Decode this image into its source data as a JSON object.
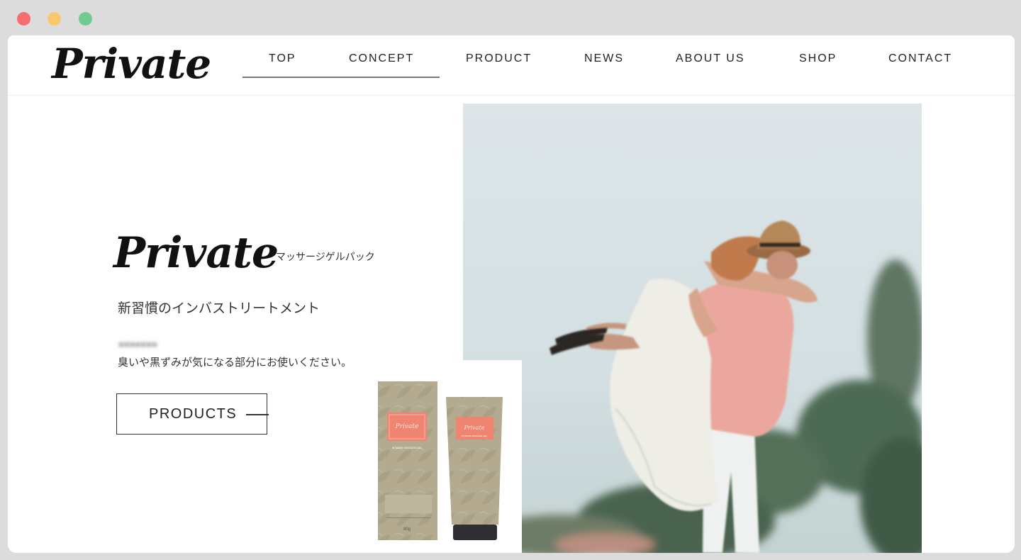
{
  "window": {
    "colors": {
      "close": "#f76d6f",
      "minimize": "#f9c86b",
      "maximize": "#72cb8e"
    }
  },
  "header": {
    "logo": "Private",
    "nav": [
      {
        "label": "TOP"
      },
      {
        "label": "CONCEPT"
      },
      {
        "label": "PRODUCT"
      },
      {
        "label": "NEWS"
      },
      {
        "label": "ABOUT US"
      },
      {
        "label": "SHOP"
      },
      {
        "label": "CONTACT"
      }
    ]
  },
  "hero": {
    "title": "Private",
    "subtitle": "マッサージゲルパック",
    "tagline": "新習慣のインバストリートメント",
    "description": "臭いや黒ずみが気になる部分にお使いください。",
    "button_label": "PRODUCTS"
  },
  "product": {
    "box_brand": "Private",
    "box_label": "INTIMATE MASSAGE GEL",
    "tube_brand": "Private",
    "tube_label": "INTIMATE MASSAGE GEL",
    "weight": "80g"
  },
  "colors": {
    "accent": "#777777",
    "package": "#b3aa90",
    "label": "#ef8470"
  }
}
